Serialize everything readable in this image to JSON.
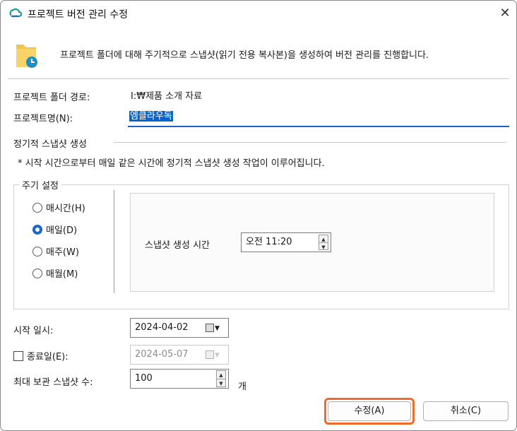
{
  "window": {
    "title": "프로젝트 버전 관리 수정",
    "description": "프로젝트 폴더에 대해 주기적으로 스냅샷(읽기 전용 복사본)을 생성하여 버전 관리를 진행합니다."
  },
  "folder_path": {
    "label": "프로젝트 폴더 경로:",
    "value": "I:₩제품 소개 자료"
  },
  "project_name": {
    "label": "프로젝트명(N):",
    "value": "엠클라우독"
  },
  "periodic": {
    "section_title": "정기적 스냅샷 생성",
    "note": "* 시작 시간으로부터 매일 같은 시간에 정기적 스냅샷 생성 작업이 이루어집니다.",
    "cycle_group_title": "주기 설정",
    "options": [
      "매시간(H)",
      "매일(D)",
      "매주(W)",
      "매월(M)"
    ],
    "selected_option": "매일(D)",
    "time_label": "스냅샷 생성 시간",
    "time_value": "오전 11:20"
  },
  "start": {
    "label": "시작 일시:",
    "value": "2024-04-02"
  },
  "end": {
    "label": "종료일(E):",
    "value": "2024-05-07",
    "checked": false
  },
  "max_snapshots": {
    "label": "최대 보관 스냅샷 수:",
    "value": "100",
    "unit": "개"
  },
  "buttons": {
    "ok": "수정(A)",
    "cancel": "취소(C)"
  },
  "icons": {
    "app": "cloud-logo-icon",
    "header": "folder-clock-icon",
    "close": "close-icon",
    "calendar": "calendar-dropdown-icon"
  },
  "colors": {
    "accent": "#1b66c9",
    "selection": "#0a64c8",
    "highlight": "#f06a2a"
  }
}
